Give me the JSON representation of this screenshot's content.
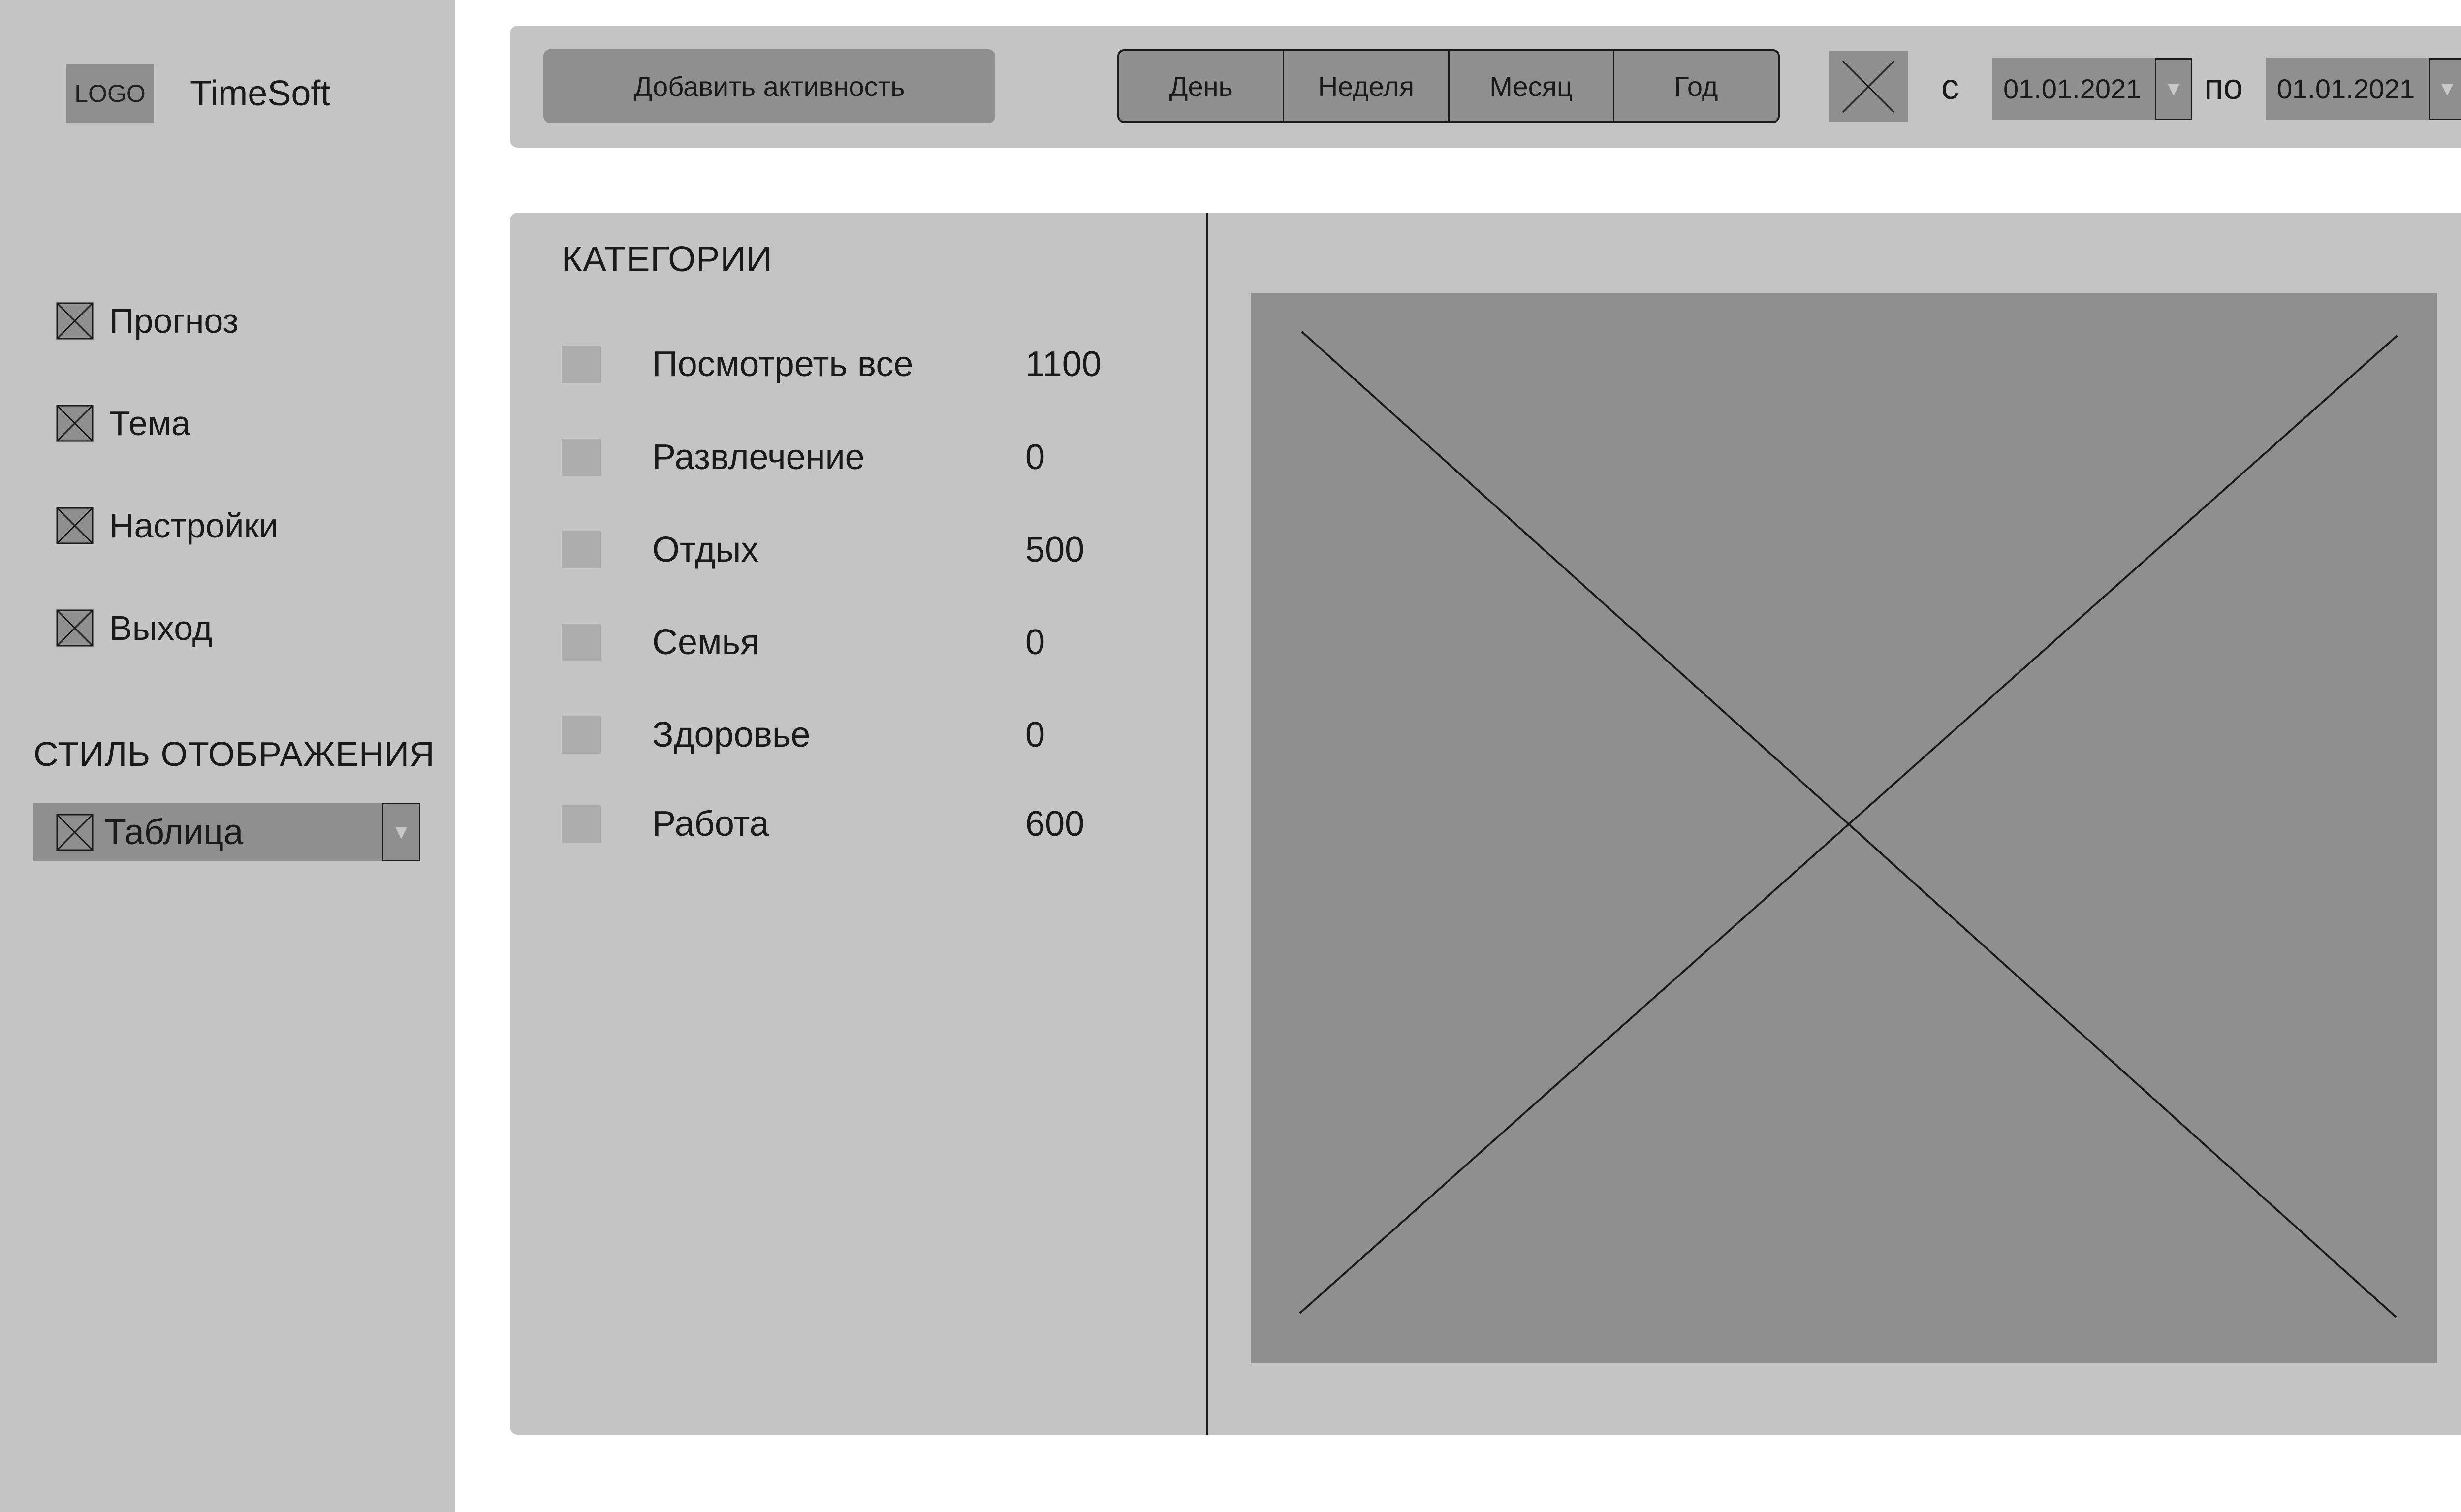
{
  "sidebar": {
    "logo": "LOGO",
    "app_title": "TimeSoft",
    "nav": [
      {
        "label": "Прогноз",
        "icon": "placeholder-x-icon"
      },
      {
        "label": "Тема",
        "icon": "placeholder-x-icon"
      },
      {
        "label": "Настройки",
        "icon": "placeholder-x-icon"
      },
      {
        "label": "Выход",
        "icon": "placeholder-x-icon"
      }
    ],
    "display_style": {
      "title": "СТИЛЬ ОТОБРАЖЕНИЯ",
      "selected": "Таблица",
      "icon": "placeholder-x-icon"
    }
  },
  "toolbar": {
    "add_label": "Добавить активность",
    "periods": [
      "День",
      "Неделя",
      "Месяц",
      "Год"
    ],
    "calendar_icon": "placeholder-x-icon",
    "from_label": "с",
    "from_date": "01.01.2021",
    "to_label": "по",
    "to_date": "01.01.2021"
  },
  "categories": {
    "title": "КАТЕГОРИИ",
    "items": [
      {
        "label": "Посмотреть все",
        "value": "1100"
      },
      {
        "label": "Развлечение",
        "value": "0"
      },
      {
        "label": "Отдых",
        "value": "500"
      },
      {
        "label": "Семья",
        "value": "0"
      },
      {
        "label": "Здоровье",
        "value": "0"
      },
      {
        "label": "Работа",
        "value": "600"
      }
    ]
  },
  "colors": {
    "panel": "#c4c4c4",
    "control": "#8f8f8f",
    "checkbox": "#adadad",
    "ink": "#1a1a1a"
  }
}
